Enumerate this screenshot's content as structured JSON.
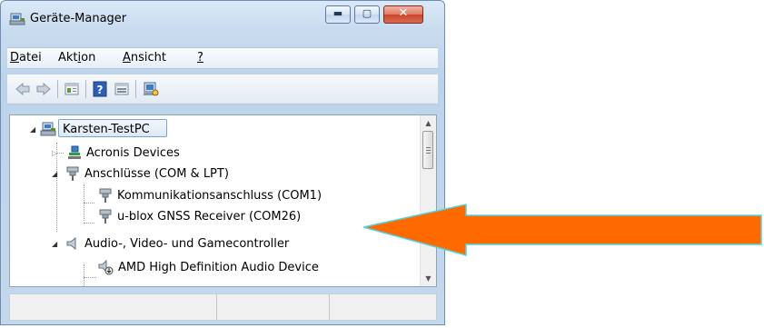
{
  "window": {
    "title": "Geräte-Manager",
    "controls": {
      "minimize": "▬",
      "maximize": "▢",
      "close": "✕"
    }
  },
  "menubar": {
    "items": [
      {
        "label_u": "D",
        "label_rest": "atei"
      },
      {
        "label_pre": "Akt",
        "label_u": "i",
        "label_rest": "on"
      },
      {
        "label_u": "A",
        "label_rest": "nsicht"
      },
      {
        "label_u": "?",
        "label_rest": ""
      }
    ]
  },
  "toolbar": {
    "icons": [
      "back-arrow-icon",
      "forward-arrow-icon",
      "properties-icon",
      "help-icon",
      "view-icon",
      "device-scan-icon"
    ]
  },
  "tree": {
    "root": "Karsten-TestPC",
    "items": [
      {
        "label": "Acronis Devices"
      },
      {
        "label": "Anschlüsse (COM & LPT)"
      },
      {
        "label": "Kommunikationsanschluss (COM1)"
      },
      {
        "label": "u-blox GNSS Receiver (COM26)"
      },
      {
        "label": "Audio-, Video- und Gamecontroller"
      },
      {
        "label": "AMD High Definition Audio Device"
      }
    ]
  },
  "colors": {
    "arrow_fill": "#ff6a00",
    "arrow_stroke": "#4fd6e6"
  }
}
